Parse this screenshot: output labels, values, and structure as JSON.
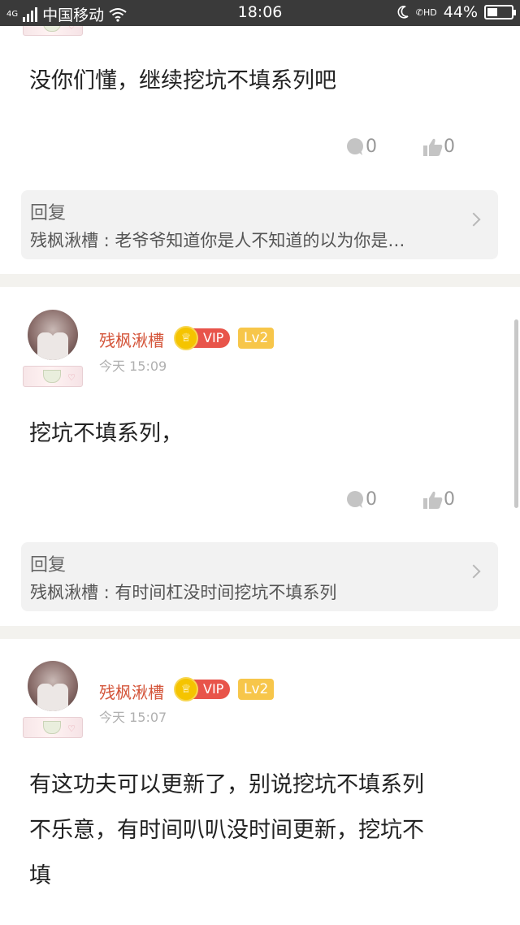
{
  "status": {
    "network_tag": "4G",
    "carrier": "中国移动",
    "time": "18:06",
    "hd": "HD",
    "battery": "44%",
    "battery_level": 0.44
  },
  "comments": [
    {
      "text": "没你们懂，继续挖坑不填系列吧",
      "comment_count": "0",
      "like_count": "0",
      "reply_title": "回复",
      "reply_text": "残枫湫槽 : 老爷爷知道你是人不知道的以为你是…"
    },
    {
      "username": "残枫湫槽",
      "vip": "VIP",
      "level": "Lv2",
      "time": "今天 15:09",
      "text": "挖坑不填系列，",
      "comment_count": "0",
      "like_count": "0",
      "reply_title": "回复",
      "reply_text": "残枫湫槽 : 有时间杠没时间挖坑不填系列"
    },
    {
      "username": "残枫湫槽",
      "vip": "VIP",
      "level": "Lv2",
      "time": "今天 15:07",
      "text_line1": "有这功夫可以更新了，别说挖坑不填系列",
      "text_line2": "不乐意，有时间叭叭没时间更新，挖坑不",
      "text_line3": "填"
    }
  ],
  "icons": {
    "comment": "comment-bubble-icon",
    "like": "thumbs-up-icon",
    "chevron": "chevron-right-icon",
    "crown": "crown-icon"
  },
  "colors": {
    "username": "#d4553a",
    "vip_badge": "#e8544a",
    "level_badge": "#f7c64a",
    "divider": "#f3f2ee"
  }
}
